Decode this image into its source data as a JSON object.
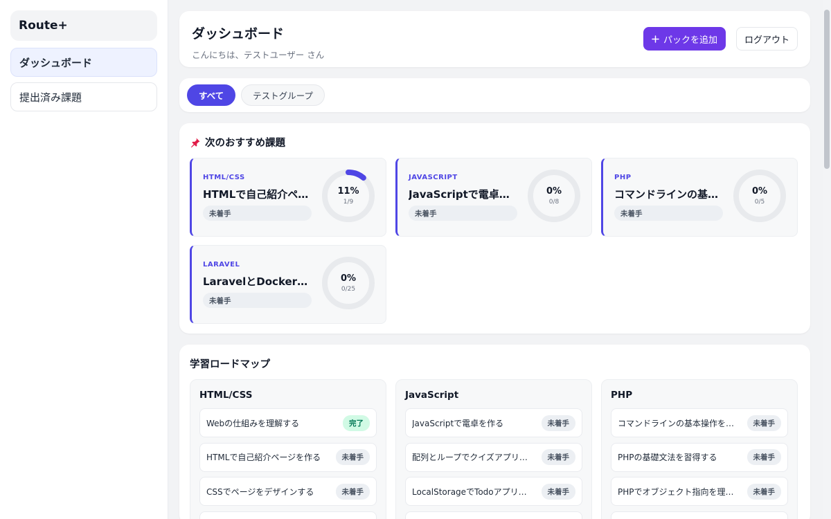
{
  "sidebar": {
    "brand": "Route+",
    "items": [
      {
        "label": "ダッシュボード",
        "active": true
      },
      {
        "label": "提出済み課題",
        "active": false
      }
    ]
  },
  "header": {
    "title": "ダッシュボード",
    "greeting": "こんにちは、テストユーザー さん",
    "add_pack_label": "パックを追加",
    "logout_label": "ログアウト"
  },
  "filters": [
    "すべて",
    "テストグループ"
  ],
  "recommended": {
    "title": "次のおすすめ課題",
    "items": [
      {
        "tag": "HTML/CSS",
        "title": "HTMLで自己紹介ペ…",
        "status": "未着手",
        "percent": "11%",
        "fraction": "1/9",
        "progress": 0.111
      },
      {
        "tag": "JAVASCRIPT",
        "title": "JavaScriptで電卓を…",
        "status": "未着手",
        "percent": "0%",
        "fraction": "0/8",
        "progress": 0
      },
      {
        "tag": "PHP",
        "title": "コマンドラインの基…",
        "status": "未着手",
        "percent": "0%",
        "fraction": "0/5",
        "progress": 0
      },
      {
        "tag": "LARAVEL",
        "title": "LaravelとDockerで…",
        "status": "未着手",
        "percent": "0%",
        "fraction": "0/25",
        "progress": 0
      }
    ]
  },
  "roadmap": {
    "title": "学習ロードマップ",
    "columns": [
      {
        "title": "HTML/CSS",
        "items": [
          {
            "name": "Webの仕組みを理解する",
            "status": "完了",
            "done": true
          },
          {
            "name": "HTMLで自己紹介ページを作る",
            "status": "未着手",
            "done": false
          },
          {
            "name": "CSSでページをデザインする",
            "status": "未着手",
            "done": false
          },
          {
            "name": "",
            "status": "",
            "done": false
          }
        ]
      },
      {
        "title": "JavaScript",
        "items": [
          {
            "name": "JavaScriptで電卓を作る",
            "status": "未着手",
            "done": false
          },
          {
            "name": "配列とループでクイズアプリ…",
            "status": "未着手",
            "done": false
          },
          {
            "name": "LocalStorageでTodoアプリを…",
            "status": "未着手",
            "done": false
          },
          {
            "name": "",
            "status": "",
            "done": false
          }
        ]
      },
      {
        "title": "PHP",
        "items": [
          {
            "name": "コマンドラインの基本操作を…",
            "status": "未着手",
            "done": false
          },
          {
            "name": "PHPの基礎文法を習得する",
            "status": "未着手",
            "done": false
          },
          {
            "name": "PHPでオブジェクト指向を理…",
            "status": "未着手",
            "done": false
          },
          {
            "name": "",
            "status": "",
            "done": false
          }
        ]
      }
    ]
  },
  "colors": {
    "accent": "#4f46e5",
    "primary_button": "#6d38e8",
    "done_badge": "#d1fae5",
    "ring_track": "#e8eaed"
  },
  "icons": {
    "pin": "pushpin-icon",
    "plus": "plus-icon"
  }
}
